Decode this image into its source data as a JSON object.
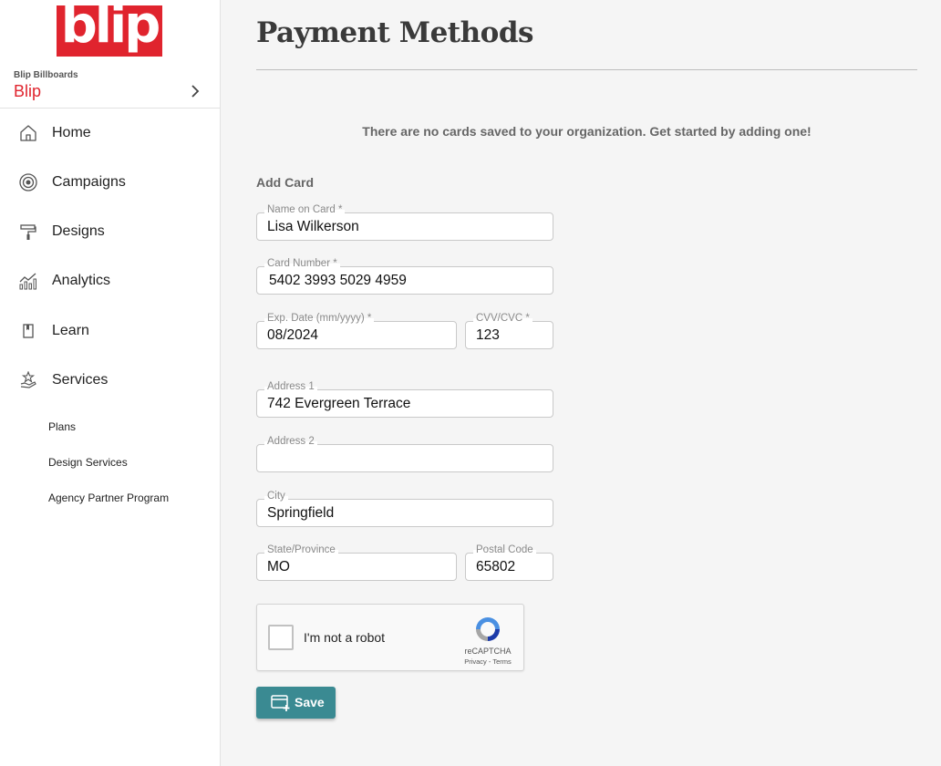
{
  "brand": {
    "logo_text": "blip",
    "accent_color": "#e0242e"
  },
  "org": {
    "subtitle": "Blip Billboards",
    "name": "Blip",
    "chevron_icon": "chevron-right-icon"
  },
  "nav": {
    "items": [
      {
        "label": "Home",
        "icon": "home-icon"
      },
      {
        "label": "Campaigns",
        "icon": "target-icon"
      },
      {
        "label": "Designs",
        "icon": "paint-roller-icon"
      },
      {
        "label": "Analytics",
        "icon": "chart-icon"
      },
      {
        "label": "Learn",
        "icon": "book-icon"
      },
      {
        "label": "Services",
        "icon": "hand-star-icon"
      }
    ],
    "sub_items": [
      {
        "label": "Plans"
      },
      {
        "label": "Design Services"
      },
      {
        "label": "Agency Partner Program"
      }
    ]
  },
  "page": {
    "title": "Payment Methods",
    "empty_message": "There are no cards saved to your organization. Get started by adding one!",
    "section_label": "Add Card"
  },
  "form": {
    "name_on_card": {
      "label": "Name on Card *",
      "value": "Lisa Wilkerson"
    },
    "card_number": {
      "label": "Card Number *",
      "value": "5402 3993 5029 4959"
    },
    "exp_date": {
      "label": "Exp. Date (mm/yyyy) *",
      "value": "08/2024"
    },
    "cvv": {
      "label": "CVV/CVC *",
      "value": "123"
    },
    "address1": {
      "label": "Address 1",
      "value": "742 Evergreen Terrace"
    },
    "address2": {
      "label": "Address 2",
      "value": ""
    },
    "city": {
      "label": "City",
      "value": "Springfield"
    },
    "state": {
      "label": "State/Province",
      "value": "MO"
    },
    "postal": {
      "label": "Postal Code",
      "value": "65802"
    }
  },
  "captcha": {
    "text": "I'm not a robot",
    "brand": "reCAPTCHA",
    "terms": "Privacy - Terms"
  },
  "save_button": {
    "label": "Save",
    "color": "#3a8a92",
    "icon": "card-add-icon"
  }
}
